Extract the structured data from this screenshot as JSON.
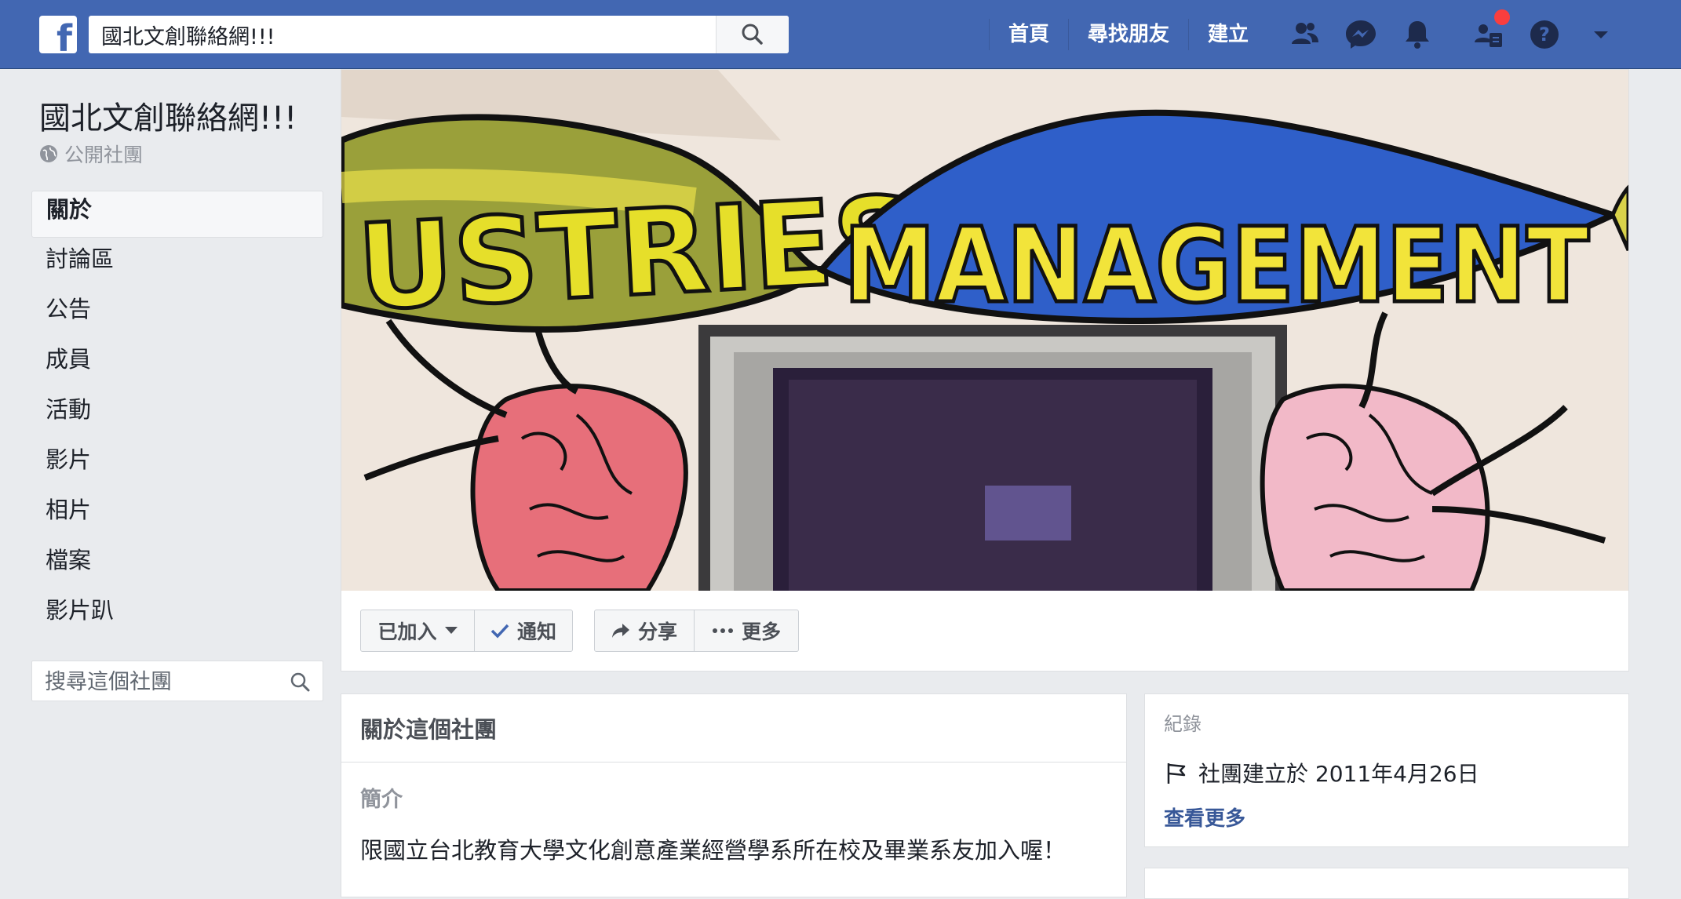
{
  "topbar": {
    "search_value": "國北文創聯絡網!!!",
    "nav": [
      "首頁",
      "尋找朋友",
      "建立"
    ],
    "icons": [
      "friend-requests-icon",
      "messenger-icon",
      "notifications-icon",
      "group-admin-icon",
      "help-icon",
      "account-menu-icon"
    ],
    "brand_color": "#4267b2",
    "badge_color": "#fa3e3e"
  },
  "group": {
    "name": "國北文創聯絡網!!!",
    "privacy": "公開社團"
  },
  "sidebar": {
    "items": [
      {
        "label": "關於",
        "active": true
      },
      {
        "label": "討論區"
      },
      {
        "label": "公告"
      },
      {
        "label": "成員"
      },
      {
        "label": "活動"
      },
      {
        "label": "影片"
      },
      {
        "label": "相片"
      },
      {
        "label": "檔案"
      },
      {
        "label": "影片趴"
      }
    ],
    "search_placeholder": "搜尋這個社團"
  },
  "cover": {
    "mural_words": [
      "USTRIES",
      "MANAGEMENT"
    ]
  },
  "actions": {
    "joined": "已加入",
    "notify": "通知",
    "share": "分享",
    "more": "更多"
  },
  "about": {
    "title": "關於這個社團",
    "intro_label": "簡介",
    "intro_text": "限國立台北教育大學文化創意產業經營學系所在校及畢業系友加入喔！"
  },
  "records": {
    "title": "紀錄",
    "created": "社團建立於 2011年4月26日",
    "see_more": "查看更多"
  }
}
